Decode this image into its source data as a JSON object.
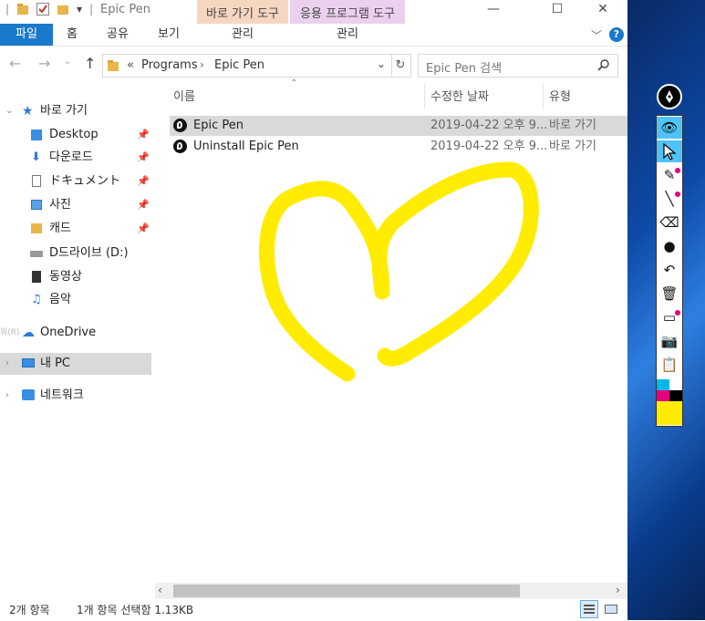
{
  "window": {
    "title": "Epic Pen",
    "context_tabs": [
      {
        "label": "바로 가기 도구",
        "color": "#f7d6c1"
      },
      {
        "label": "응용 프로그램 도구",
        "color": "#ebd1ee"
      }
    ]
  },
  "ribbon": {
    "tabs": [
      "파일",
      "홈",
      "공유",
      "보기"
    ],
    "context_labels": [
      "관리",
      "관리"
    ],
    "file_tab_color": "#1979ca"
  },
  "address": {
    "path_prefix": "«",
    "crumbs": [
      "Programs",
      "Epic Pen"
    ],
    "search_placeholder": "Epic Pen 검색"
  },
  "nav": {
    "quick_access": "바로 가기",
    "quick_items": [
      "Desktop",
      "다운로드",
      "ドキュメント",
      "사진",
      "캐드"
    ],
    "drive": "D드라이브 (D:)",
    "video": "동영상",
    "music": "음악",
    "onedrive": "OneDrive",
    "onedrive_prefix": "워(R)",
    "this_pc": "내 PC",
    "network": "네트워크"
  },
  "list": {
    "columns": [
      "이름",
      "수정한 날짜",
      "유형"
    ],
    "rows": [
      {
        "name": "Epic Pen",
        "modified": "2019-04-22 오후 9...",
        "type": "바로 가기",
        "selected": true
      },
      {
        "name": "Uninstall Epic Pen",
        "modified": "2019-04-22 오후 9...",
        "type": "바로 가기",
        "selected": false
      }
    ]
  },
  "status": {
    "count": "2개 항목",
    "selection": "1개 항목 선택함 1.13KB"
  },
  "drawing": {
    "stroke_color": "#ffec00",
    "shape": "heart"
  },
  "epic_pen": {
    "tools": [
      "eye-icon",
      "cursor-icon",
      "pen-icon",
      "highlighter-icon",
      "eraser-icon",
      "dot-icon",
      "undo-icon",
      "trash-icon",
      "whiteboard-icon",
      "camera-icon",
      "clipboard-icon"
    ],
    "active_tool": "cursor-icon",
    "palette": [
      "#00b7eb",
      "#ffffff",
      "#e6007e",
      "#000000",
      "#ffec00",
      "#ffec00"
    ]
  }
}
